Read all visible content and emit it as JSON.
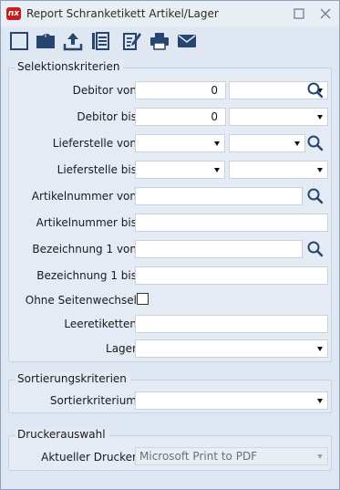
{
  "window": {
    "logo_text": "nx",
    "title": "Report Schranketikett Artikel/Lager"
  },
  "selection": {
    "title": "Selektionskriterien",
    "debitor_von": {
      "label": "Debitor von",
      "value": "0"
    },
    "debitor_bis": {
      "label": "Debitor bis",
      "value": "0"
    },
    "lieferstelle_von": {
      "label": "Lieferstelle von"
    },
    "lieferstelle_bis": {
      "label": "Lieferstelle bis"
    },
    "artikelnummer_von": {
      "label": "Artikelnummer von",
      "value": ""
    },
    "artikelnummer_bis": {
      "label": "Artikelnummer bis",
      "value": ""
    },
    "bezeichnung_von": {
      "label": "Bezeichnung 1 von",
      "value": ""
    },
    "bezeichnung_bis": {
      "label": "Bezeichnung 1 bis",
      "value": ""
    },
    "ohne_seitenwechsel": {
      "label": "Ohne Seitenwechsel",
      "checked": false
    },
    "leeretiketten": {
      "label": "Leeretiketten",
      "value": ""
    },
    "lager": {
      "label": "Lager",
      "value": ""
    }
  },
  "sorting": {
    "title": "Sortierungskriterien",
    "sortierkriterium": {
      "label": "Sortierkriterium",
      "value": ""
    }
  },
  "printer": {
    "title": "Druckerauswahl",
    "aktueller_drucker": {
      "label": "Aktueller Drucker",
      "value": "Microsoft Print to PDF"
    }
  },
  "colors": {
    "accent": "#26466f",
    "logo": "#c81e1e",
    "background": "#dfe7f2"
  },
  "icons": [
    "new-icon",
    "open-folder-icon",
    "upload-icon",
    "list-icon",
    "edit-icon",
    "print-icon",
    "email-icon",
    "search-icon",
    "maximize-icon",
    "close-icon"
  ]
}
